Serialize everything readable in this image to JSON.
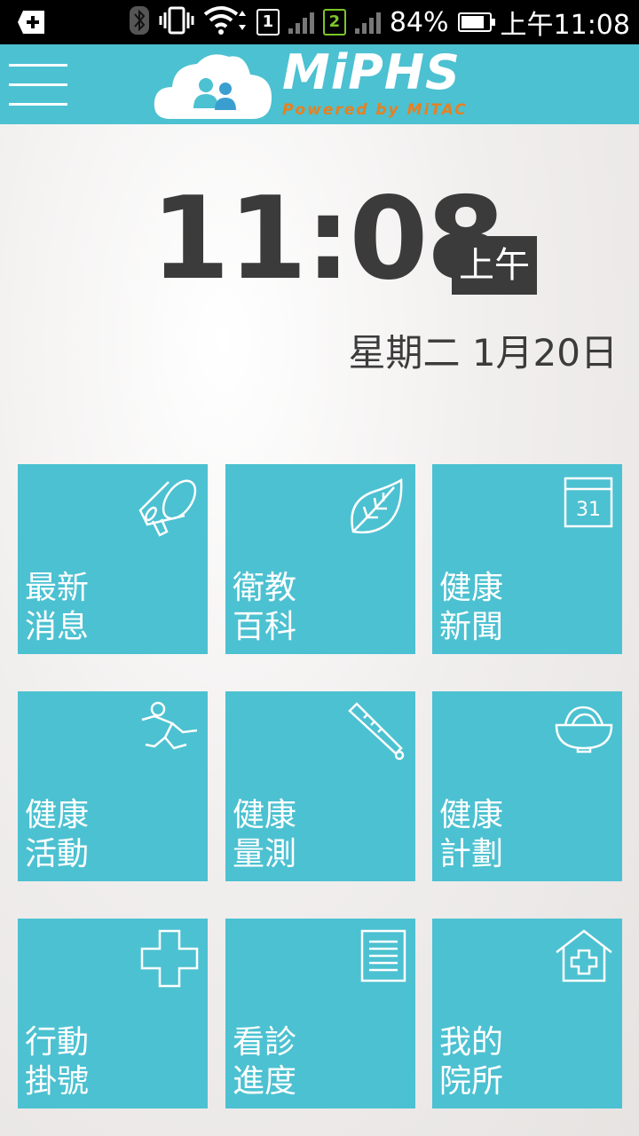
{
  "status_bar": {
    "battery": "84%",
    "time": "上午11:08",
    "sim1": "1",
    "sim2": "2"
  },
  "header": {
    "title": "MiPHS",
    "subtitle": "Powered by MiTAC",
    "accent_color": "#4cc1d1",
    "subtitle_color": "#e8801f"
  },
  "clock": {
    "time": "11:08",
    "ampm": "上午",
    "date": "星期二 1月20日"
  },
  "tiles": [
    {
      "line1": "最新",
      "line2": "消息",
      "icon": "megaphone-icon"
    },
    {
      "line1": "衛教",
      "line2": "百科",
      "icon": "leaf-icon"
    },
    {
      "line1": "健康",
      "line2": "新聞",
      "icon": "calendar-icon",
      "icon_text": "31"
    },
    {
      "line1": "健康",
      "line2": "活動",
      "icon": "running-person-icon"
    },
    {
      "line1": "健康",
      "line2": "量測",
      "icon": "thermometer-icon"
    },
    {
      "line1": "健康",
      "line2": "計劃",
      "icon": "food-bowl-icon"
    },
    {
      "line1": "行動",
      "line2": "掛號",
      "icon": "medical-cross-icon"
    },
    {
      "line1": "看診",
      "line2": "進度",
      "icon": "document-icon"
    },
    {
      "line1": "我的",
      "line2": "院所",
      "icon": "hospital-icon"
    }
  ]
}
